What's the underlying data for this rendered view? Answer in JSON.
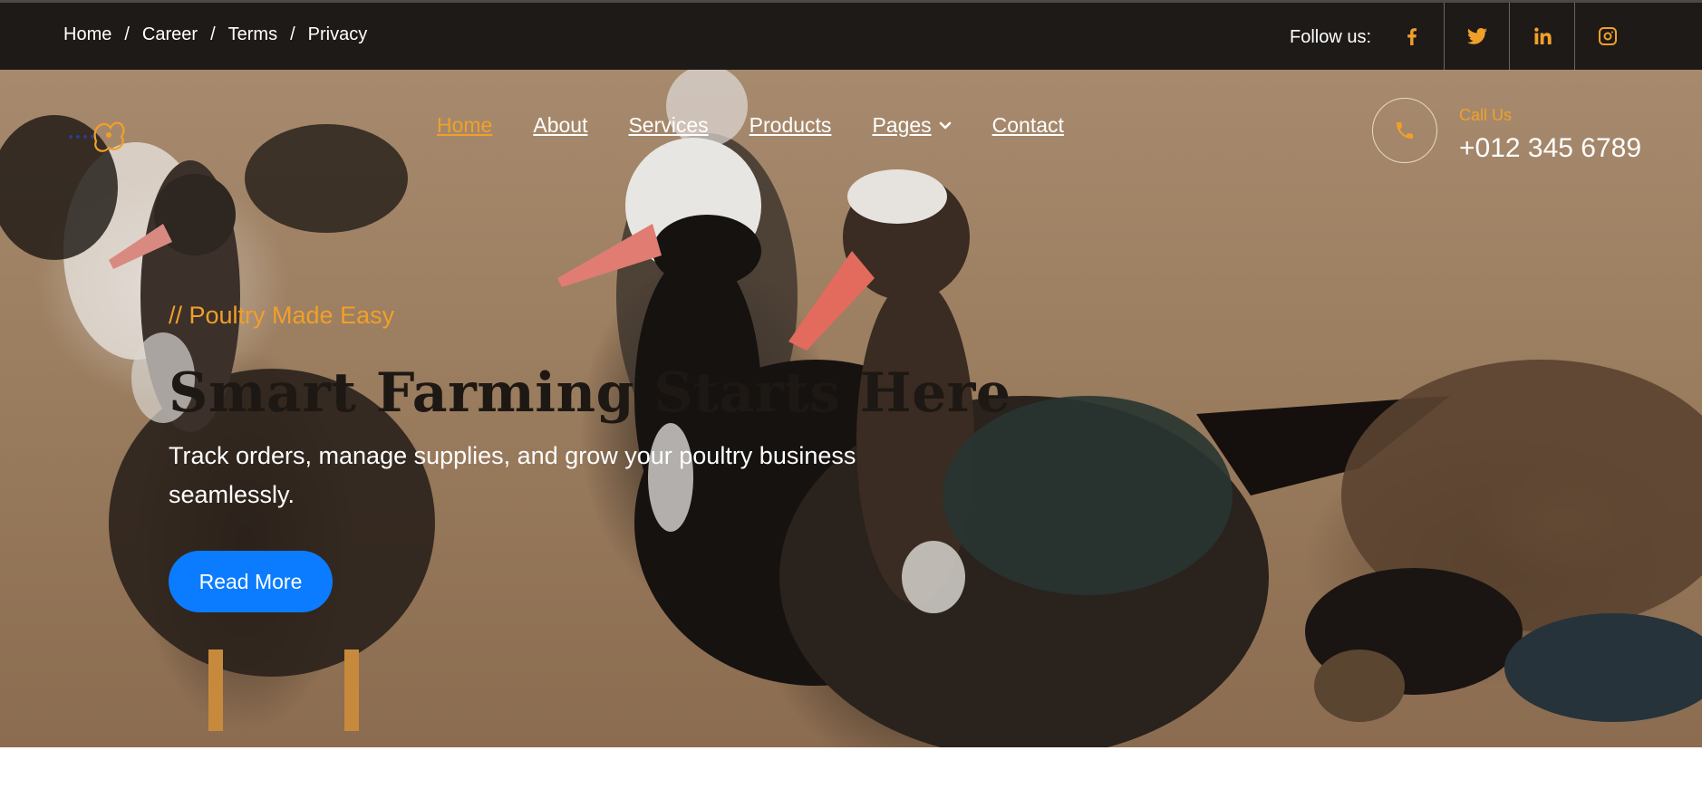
{
  "topbar": {
    "breadcrumbs": [
      "Home",
      "Career",
      "Terms",
      "Privacy"
    ],
    "separator": "/",
    "follow_label": "Follow us:",
    "social": [
      "facebook-icon",
      "twitter-icon",
      "linkedin-icon",
      "instagram-icon"
    ]
  },
  "nav": {
    "items": [
      {
        "label": "Home",
        "active": true
      },
      {
        "label": "About"
      },
      {
        "label": "Services"
      },
      {
        "label": "Products"
      },
      {
        "label": "Pages",
        "has_dropdown": true
      },
      {
        "label": "Contact"
      }
    ],
    "call_label": "Call Us",
    "call_number": "+012 345 6789"
  },
  "hero": {
    "tagline": "// Poultry Made Easy",
    "headline": "Smart Farming Starts Here",
    "subtitle": "Track orders, manage supplies, and grow your poultry business seamlessly.",
    "cta_label": "Read More"
  },
  "colors": {
    "accent": "#f0a02a",
    "topbar_bg": "#1e1a18",
    "button_blue": "#0b7cff",
    "headline": "#1e1814"
  }
}
